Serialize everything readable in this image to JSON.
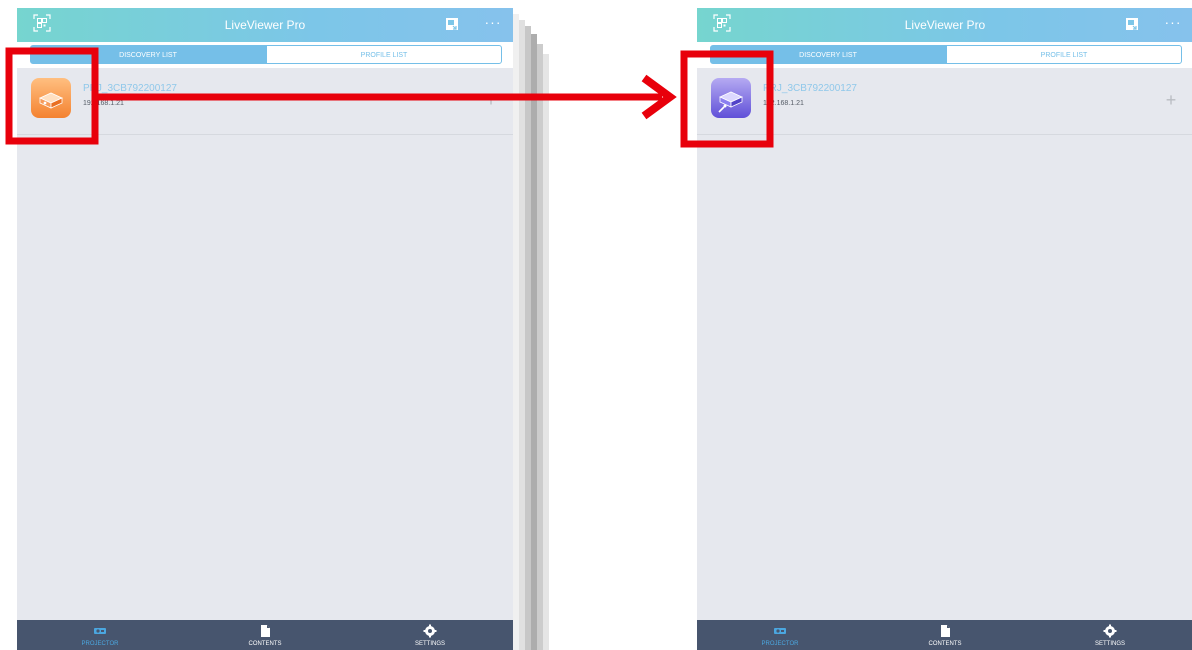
{
  "app": {
    "title": "LiveViewer Pro",
    "more_label": "···"
  },
  "segments": {
    "discovery": "DISCOVERY LIST",
    "profile": "PROFILE LIST"
  },
  "device": {
    "name": "PRJ_3CB792200127",
    "ip": "192.168.1.21",
    "add_label": "+"
  },
  "tabs": {
    "projector": "PROJECTOR",
    "contents": "CONTENTS",
    "settings": "SETTINGS"
  },
  "icons": {
    "qr": "qr-scan-icon",
    "export": "export-icon",
    "more": "more-icon",
    "projector_orange": "projector-icon-orange",
    "projector_purple": "projector-icon-purple",
    "add": "add-icon",
    "projector_tab": "projector-tab-icon",
    "contents_tab": "document-icon",
    "settings_tab": "gear-icon"
  },
  "colors": {
    "header_start": "#76d5cf",
    "header_end": "#86c2ec",
    "segment_active": "#75bfe8",
    "tabbar": "#47556e",
    "tab_active": "#4ba7e0",
    "device_name": "#8fc8ea",
    "icon_orange": "#f48230",
    "icon_purple": "#6050d8",
    "annotation": "#e8000b"
  }
}
